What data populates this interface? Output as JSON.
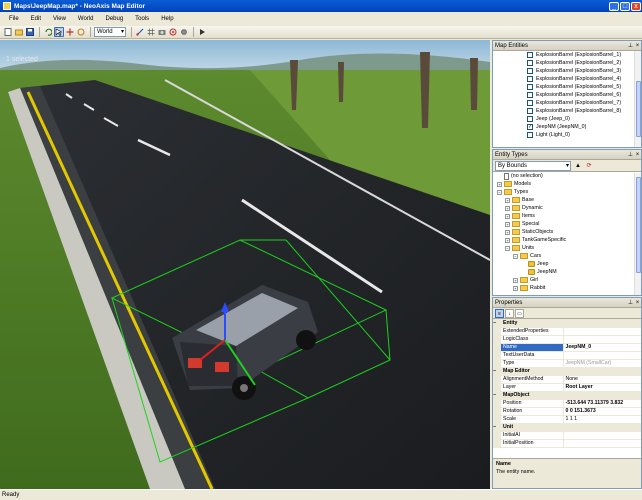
{
  "window": {
    "title": "Maps\\JeepMap.map* - NeoAxis Map Editor",
    "buttons": {
      "minimize": "_",
      "maximize": "□",
      "close": "x"
    }
  },
  "menu": [
    "File",
    "Edit",
    "View",
    "World",
    "Debug",
    "Tools",
    "Help"
  ],
  "toolbar": {
    "coordinate_mode": "World",
    "icons": [
      "new-icon",
      "open-icon",
      "save-icon",
      "undo-icon",
      "select-icon",
      "move-icon",
      "rotate-icon",
      "scale-icon",
      "snap-icon",
      "grid-icon",
      "camera-icon",
      "target-icon",
      "settings-icon",
      "play-icon"
    ]
  },
  "viewport": {
    "selection_text": "1 selected"
  },
  "map_entities": {
    "title": "Map Entities",
    "items": [
      {
        "label": "ExplosionBarrel (ExplosionBarrel_1)",
        "checked": false
      },
      {
        "label": "ExplosionBarrel (ExplosionBarrel_2)",
        "checked": false
      },
      {
        "label": "ExplosionBarrel (ExplosionBarrel_3)",
        "checked": false
      },
      {
        "label": "ExplosionBarrel (ExplosionBarrel_4)",
        "checked": false
      },
      {
        "label": "ExplosionBarrel (ExplosionBarrel_5)",
        "checked": false
      },
      {
        "label": "ExplosionBarrel (ExplosionBarrel_6)",
        "checked": false
      },
      {
        "label": "ExplosionBarrel (ExplosionBarrel_7)",
        "checked": false
      },
      {
        "label": "ExplosionBarrel (ExplosionBarrel_8)",
        "checked": false
      },
      {
        "label": "Jeep (Jeep_0)",
        "checked": false
      },
      {
        "label": "JeepNM (JeepNM_0)",
        "checked": true
      },
      {
        "label": "Light (Light_0)",
        "checked": false
      }
    ]
  },
  "entity_types": {
    "title": "Entity Types",
    "filter": "By Bounds",
    "tree": [
      {
        "label": "(no selection)",
        "kind": "file",
        "expander": "",
        "depth": 0
      },
      {
        "label": "Models",
        "kind": "folder",
        "expander": "+",
        "depth": 0
      },
      {
        "label": "Types",
        "kind": "folder",
        "expander": "−",
        "depth": 0
      },
      {
        "label": "Base",
        "kind": "folder",
        "expander": "+",
        "depth": 1
      },
      {
        "label": "Dynamic",
        "kind": "folder",
        "expander": "+",
        "depth": 1
      },
      {
        "label": "Items",
        "kind": "folder",
        "expander": "+",
        "depth": 1
      },
      {
        "label": "Special",
        "kind": "folder",
        "expander": "+",
        "depth": 1
      },
      {
        "label": "StaticObjects",
        "kind": "folder",
        "expander": "+",
        "depth": 1
      },
      {
        "label": "TankGameSpecific",
        "kind": "folder",
        "expander": "+",
        "depth": 1
      },
      {
        "label": "Units",
        "kind": "folder",
        "expander": "−",
        "depth": 1
      },
      {
        "label": "Cars",
        "kind": "folder",
        "expander": "−",
        "depth": 2
      },
      {
        "label": "Jeep",
        "kind": "jeep",
        "expander": "",
        "depth": 3
      },
      {
        "label": "JeepNM",
        "kind": "jeep",
        "expander": "",
        "depth": 3
      },
      {
        "label": "Girl",
        "kind": "folder",
        "expander": "+",
        "depth": 2
      },
      {
        "label": "Rabbit",
        "kind": "folder",
        "expander": "+",
        "depth": 2
      }
    ]
  },
  "properties": {
    "title": "Properties",
    "rows": [
      {
        "type": "cat",
        "name": "Entity",
        "value": ""
      },
      {
        "type": "prop",
        "name": "ExtendedProperties",
        "value": ""
      },
      {
        "type": "prop",
        "name": "LogicClass",
        "value": ""
      },
      {
        "type": "prop",
        "name": "Name",
        "value": "JeepNM_0",
        "style": "bold",
        "selected": true
      },
      {
        "type": "prop",
        "name": "TextUserData",
        "value": ""
      },
      {
        "type": "prop",
        "name": "Type",
        "value": "JeepNM (SmallCar)",
        "style": "dim"
      },
      {
        "type": "cat",
        "name": "Map Editor",
        "value": ""
      },
      {
        "type": "prop",
        "name": "AlignmentMethod",
        "value": "None"
      },
      {
        "type": "prop",
        "name": "Layer",
        "value": "Root Layer",
        "style": "bold"
      },
      {
        "type": "cat",
        "name": "MapObject",
        "value": ""
      },
      {
        "type": "prop",
        "name": "Position",
        "value": "-513.644 73.11379 3.832",
        "style": "bold"
      },
      {
        "type": "prop",
        "name": "Rotation",
        "value": "0 0 151.3673",
        "style": "bold"
      },
      {
        "type": "prop",
        "name": "Scale",
        "value": "1 1 1"
      },
      {
        "type": "cat",
        "name": "Unit",
        "value": ""
      },
      {
        "type": "prop",
        "name": "InitialAI",
        "value": ""
      },
      {
        "type": "prop",
        "name": "InitialPosition",
        "value": ""
      }
    ],
    "description": {
      "title": "Name",
      "text": "The entity name."
    }
  },
  "status": {
    "text": "Ready"
  },
  "colors": {
    "title_bar": "#0a5ed6",
    "selection": "#316ac5",
    "bounding_box": "#1bd31b",
    "road_line": "#e3c800"
  }
}
